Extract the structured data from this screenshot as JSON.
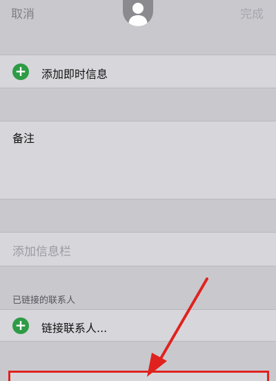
{
  "nav": {
    "cancel_label": "取消",
    "done_label": "完成"
  },
  "rows": {
    "add_instant_message": "添加即时信息",
    "note_label": "备注",
    "add_field_label": "添加信息栏",
    "linked_contacts_header": "已链接的联系人",
    "link_contact_label": "链接联系人..."
  },
  "icons": {
    "avatar": "person-silhouette",
    "add": "plus-circle-green",
    "annotation": "red-arrow"
  },
  "colors": {
    "add_icon": "#2e9b45",
    "annotation": "#e0221e",
    "background": "#c9c8cd"
  }
}
